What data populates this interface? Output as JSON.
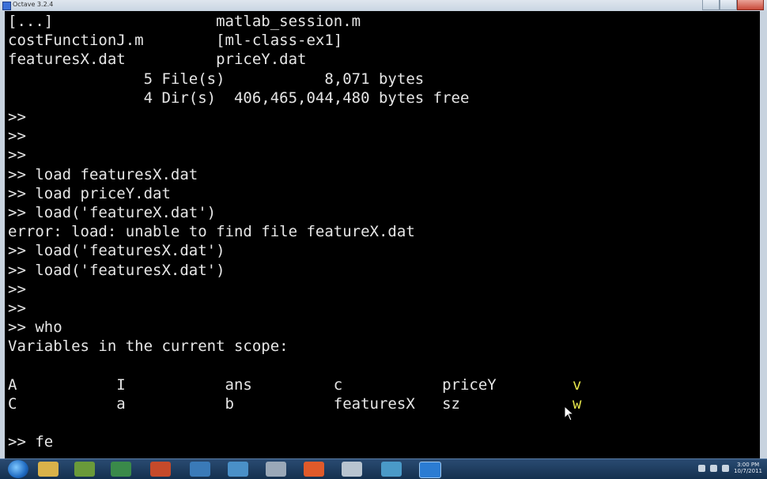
{
  "window": {
    "title": "Octave 3.2.4"
  },
  "console": {
    "lines": [
      "[...]                  matlab_session.m",
      "costFunctionJ.m        [ml-class-ex1]",
      "featuresX.dat          priceY.dat",
      "               5 File(s)           8,071 bytes",
      "               4 Dir(s)  406,465,044,480 bytes free",
      ">>",
      ">>",
      ">>",
      ">> load featuresX.dat",
      ">> load priceY.dat",
      ">> load('featureX.dat')",
      "error: load: unable to find file featureX.dat",
      ">> load('featuresX.dat')",
      ">> load('featuresX.dat')",
      ">>",
      ">>",
      ">> who",
      "Variables in the current scope:",
      "",
      "A           I           ans         c           priceY",
      "C           a           b           featuresX   sz",
      "",
      ">> fe"
    ],
    "var_col6": [
      "v",
      "w"
    ]
  },
  "taskbar": {
    "clock_time": "3:00 PM",
    "clock_date": "10/7/2011"
  },
  "colors": {
    "background": "#000000",
    "text": "#e6e6e6",
    "highlight": "#e3e34a"
  }
}
